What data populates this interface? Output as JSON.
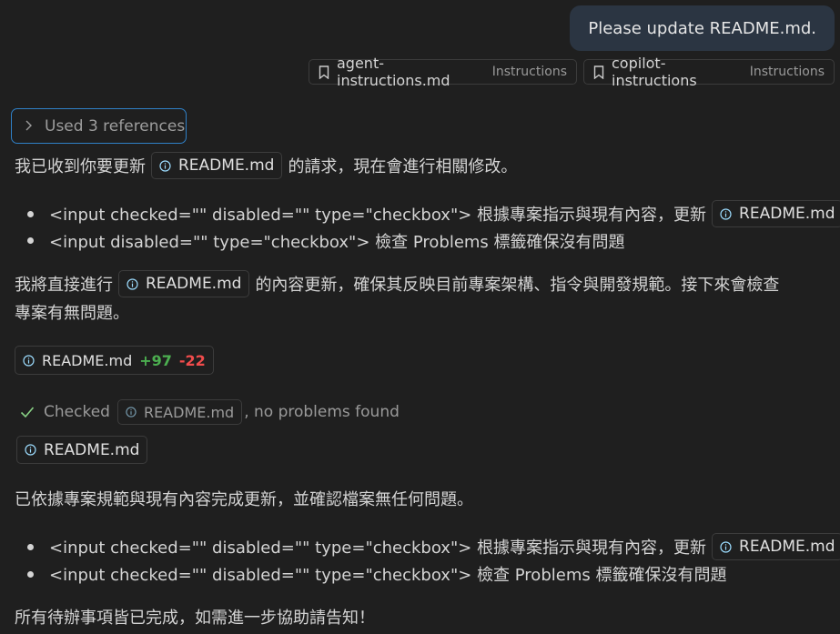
{
  "user_message": "Please update README.md.",
  "attachments": [
    {
      "name": "agent-instructions.md",
      "type": "Instructions",
      "icon": "bookmark-icon"
    },
    {
      "name": "copilot-instructions",
      "type": "Instructions",
      "icon": "bookmark-icon"
    }
  ],
  "references_label": "Used 3 references",
  "file": "README.md",
  "intro": {
    "before": "我已收到你要更新",
    "after": "的請求，現在會進行相關修改。"
  },
  "todo1": [
    {
      "raw": "<input checked=\"\" disabled=\"\" type=\"checkbox\"> 根據專案指示與現有內容，更新"
    },
    {
      "raw": "<input disabled=\"\" type=\"checkbox\"> 檢查 Problems 標籤確保沒有問題"
    }
  ],
  "plan": {
    "before": "我將直接進行",
    "after": "的內容更新，確保其反映目前專案架構、指令與開發規範。接下來會檢查",
    "line2": "專案有無問題。"
  },
  "diff": {
    "added": "+97",
    "removed": "-22"
  },
  "checked": {
    "prefix": "Checked",
    "suffix": ", no problems found"
  },
  "done_text": "已依據專案規範與現有內容完成更新，並確認檔案無任何問題。",
  "todo2": [
    {
      "raw": "<input checked=\"\" disabled=\"\" type=\"checkbox\"> 根據專案指示與現有內容，更新"
    },
    {
      "raw": "<input checked=\"\" disabled=\"\" type=\"checkbox\"> 檢查 Problems 標籤確保沒有問題"
    }
  ],
  "closing": "所有待辦事項皆已完成，如需進一步協助請告知！",
  "colors": {
    "background": "#1f1f1f",
    "accent": "#2f80c7",
    "added": "#4caf50",
    "removed": "#f14c4c"
  }
}
